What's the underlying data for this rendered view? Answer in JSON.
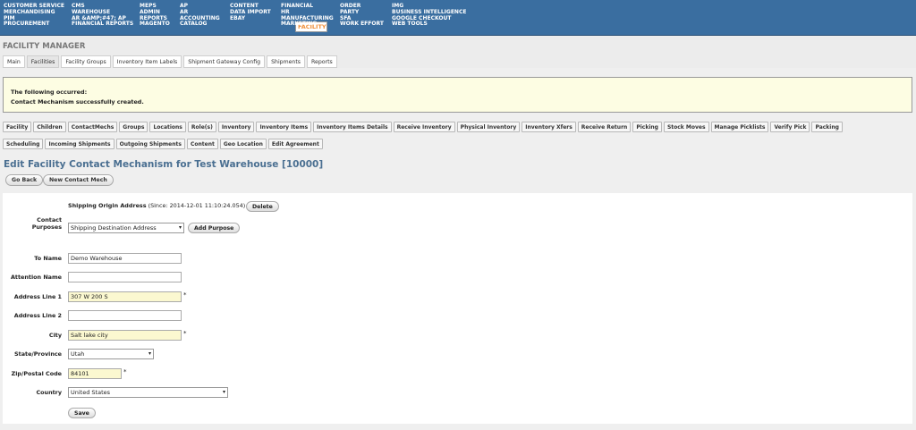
{
  "topnav": {
    "columns": [
      [
        "CUSTOMER SERVICE",
        "MERCHANDISING",
        "PIM",
        "PROCUREMENT"
      ],
      [
        "CMS",
        "WAREHOUSE",
        "AR &amp;#47; AP",
        "FINANCIAL REPORTS"
      ],
      [
        "MEPS",
        "ADMIN",
        "REPORTS",
        "MAGENTO"
      ],
      [
        "AP",
        "AR",
        "ACCOUNTING",
        "CATALOG"
      ],
      [
        "CONTENT",
        "DATA IMPORT",
        "EBAY",
        "FACILITY"
      ],
      [
        "FINANCIAL",
        "HR",
        "MANUFACTURING",
        "MARKETING"
      ],
      [
        "ORDER",
        "PARTY",
        "SFA",
        "WORK EFFORT"
      ],
      [
        "IMG",
        "BUSINESS INTELLIGENCE",
        "GOOGLE CHECKOUT",
        "WEB TOOLS"
      ]
    ],
    "active": "FACILITY",
    "active_color": "#f0913c"
  },
  "app": {
    "title": "FACILITY MANAGER",
    "tabs": [
      "Main",
      "Facilities",
      "Facility Groups",
      "Inventory Item Labels",
      "Shipment Gateway Config",
      "Shipments",
      "Reports"
    ],
    "active_tab": "Facilities"
  },
  "message": {
    "head": "The following occurred:",
    "body": "Contact Mechanism successfully created."
  },
  "subtabs": {
    "row1": [
      "Facility",
      "Children",
      "ContactMechs",
      "Groups",
      "Locations",
      "Role(s)",
      "Inventory",
      "Inventory Items",
      "Inventory Items Details",
      "Receive Inventory",
      "Physical Inventory",
      "Inventory Xfers",
      "Receive Return",
      "Picking",
      "Stock Moves",
      "Manage Picklists",
      "Verify Pick",
      "Packing"
    ],
    "row2": [
      "Scheduling",
      "Incoming Shipments",
      "Outgoing Shipments",
      "Content",
      "Geo Location",
      "Edit Agreement"
    ]
  },
  "page": {
    "title": "Edit Facility Contact Mechanism for Test Warehouse [10000]",
    "go_back": "Go Back",
    "new_contact": "New Contact Mech"
  },
  "form": {
    "contact_purposes_label": "Contact Purposes",
    "purpose_name": "Shipping Origin Address",
    "purpose_since": "(Since: 2014-12-01 11:10:24.054)",
    "delete_label": "Delete",
    "purpose_select": "Shipping Destination Address",
    "add_purpose_label": "Add Purpose",
    "to_name_label": "To Name",
    "to_name": "Demo Warehouse",
    "attention_label": "Attention Name",
    "attention": "",
    "address1_label": "Address Line 1",
    "address1": "307 W 200 S",
    "address2_label": "Address Line 2",
    "address2": "",
    "city_label": "City",
    "city": "Salt lake city",
    "state_label": "State/Province",
    "state": "Utah",
    "zip_label": "Zip/Postal Code",
    "zip": "84101",
    "country_label": "Country",
    "country": "United States",
    "required_mark": "*",
    "save_label": "Save"
  }
}
